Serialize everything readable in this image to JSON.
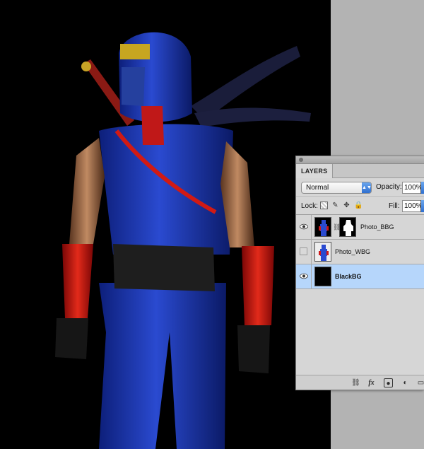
{
  "panel": {
    "tab_label": "LAYERS",
    "blend_mode": "Normal",
    "opacity_label": "Opacity:",
    "opacity_value": "100%",
    "lock_label": "Lock:",
    "fill_label": "Fill:",
    "fill_value": "100%"
  },
  "layers": [
    {
      "name": "Photo_BBG",
      "visible": true,
      "selected": false,
      "has_mask": true
    },
    {
      "name": "Photo_WBG",
      "visible": false,
      "selected": false,
      "has_mask": false
    },
    {
      "name": "BlackBG",
      "visible": true,
      "selected": true,
      "has_mask": false
    }
  ],
  "footer_icons": [
    "link-layers-icon",
    "fx-icon",
    "add-mask-icon",
    "adjustment-layer-icon",
    "new-group-icon"
  ],
  "colors": {
    "canvas_bg": "#000000",
    "workspace_bg": "#b3b3b3",
    "selected_layer": "#b6d6fb",
    "costume_blue": "#1f3fb8",
    "arm_guard_red": "#d01818"
  }
}
